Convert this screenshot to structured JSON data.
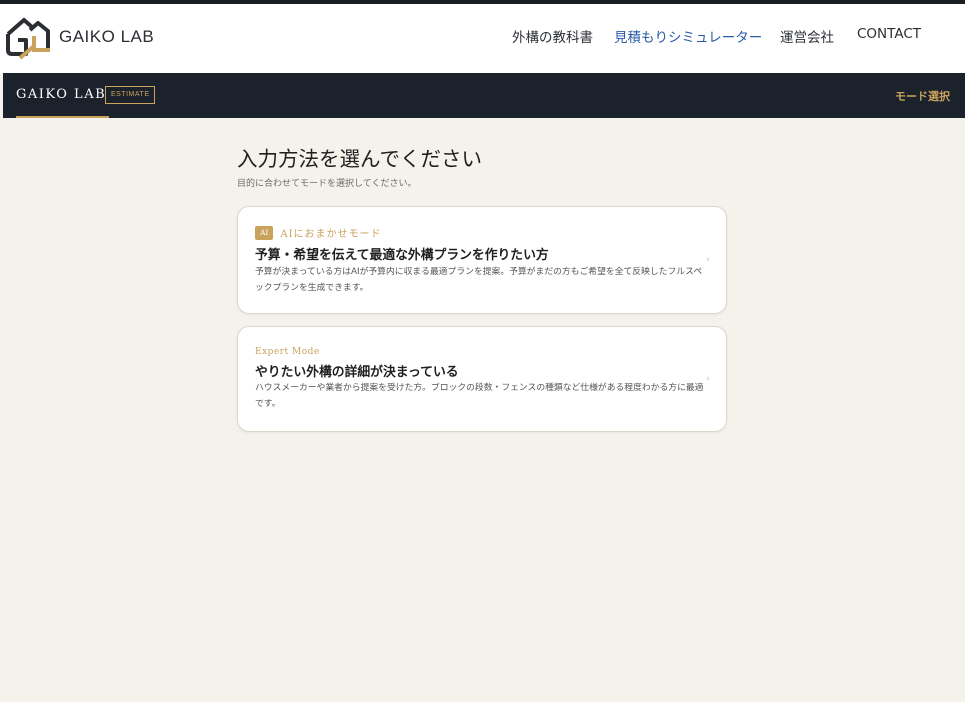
{
  "site": {
    "logo_text": "GAIKO LAB",
    "nav": [
      {
        "label": "外構の教科書",
        "active": false
      },
      {
        "label": "見積もりシミュレーター",
        "active": true
      },
      {
        "label": "運営会社",
        "active": false
      },
      {
        "label": "CONTACT",
        "active": false
      }
    ]
  },
  "app_bar": {
    "brand": "GAIKO LAB",
    "badge": "ESTIMATE",
    "mode_label": "モード選択"
  },
  "main": {
    "title": "入力方法を選んでください",
    "subtitle": "目的に合わせてモードを選択してください。",
    "cards": [
      {
        "badge": "AI",
        "mode_name": "AIにおまかせモード",
        "title": "予算・希望を伝えて最適な外構プランを作りたい方",
        "description": "予算が決まっている方はAIが予算内に収まる最適プランを提案。予算がまだの方もご希望を全て反映したフルスペックプランを生成できます。",
        "chevron": "›"
      },
      {
        "mode_name": "Expert Mode",
        "title": "やりたい外構の詳細が決まっている",
        "description": "ハウスメーカーや業者から提案を受けた方。ブロックの段数・フェンスの種類など仕様がある程度わかる方に最適です。",
        "chevron": "›"
      }
    ]
  },
  "colors": {
    "accent_gold": "#c9a25c",
    "dark_bar": "#1b222c",
    "nav_active": "#2a5aa6",
    "page_bg": "#f5f2ec"
  }
}
